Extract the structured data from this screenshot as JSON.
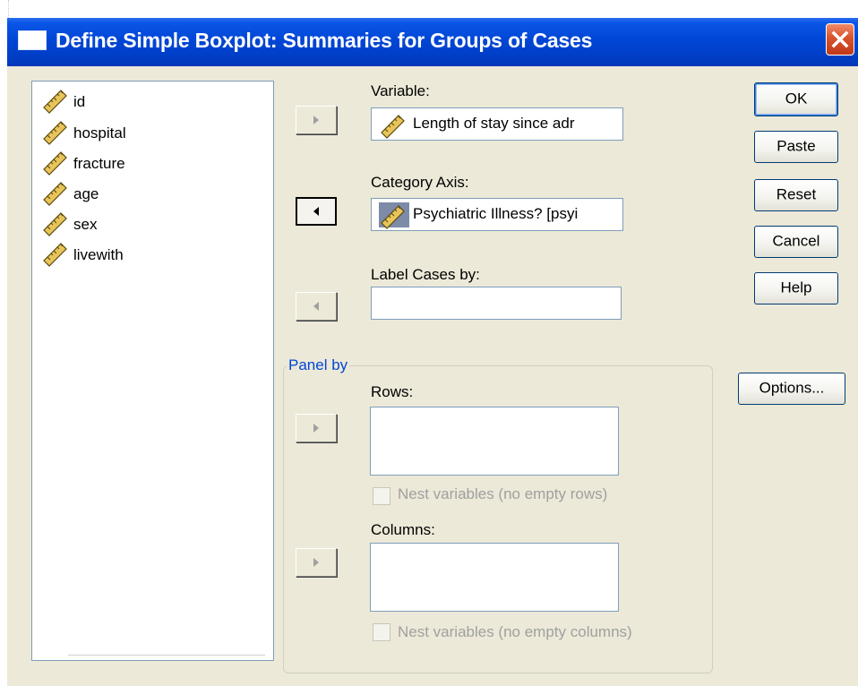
{
  "window": {
    "title": "Define Simple Boxplot: Summaries for Groups of Cases",
    "close_icon": "close-icon"
  },
  "variable_list": {
    "items": [
      {
        "label": "id",
        "icon": "scale-ruler-icon"
      },
      {
        "label": "hospital",
        "icon": "scale-ruler-icon"
      },
      {
        "label": "fracture",
        "icon": "scale-ruler-icon"
      },
      {
        "label": "age",
        "icon": "scale-ruler-icon"
      },
      {
        "label": "sex",
        "icon": "scale-ruler-icon"
      },
      {
        "label": "livewith",
        "icon": "scale-ruler-icon"
      }
    ]
  },
  "variable": {
    "label": "Variable:",
    "value": "Length of stay since adr"
  },
  "category_axis": {
    "label": "Category Axis:",
    "value": "Psychiatric Illness? [psyi"
  },
  "label_cases": {
    "label": "Label Cases by:",
    "value": ""
  },
  "panel_by": {
    "legend": "Panel by",
    "rows_label": "Rows:",
    "nest_rows_label": "Nest variables (no empty rows)",
    "columns_label": "Columns:",
    "nest_columns_label": "Nest variables (no empty columns)"
  },
  "buttons": {
    "ok": "OK",
    "paste": "Paste",
    "reset": "Reset",
    "cancel": "Cancel",
    "help": "Help",
    "options": "Options..."
  },
  "colors": {
    "titlebar": "#0046d6",
    "dialog_bg": "#ece9d8",
    "group_legend": "#0046d5",
    "close_button": "#d9532a"
  }
}
